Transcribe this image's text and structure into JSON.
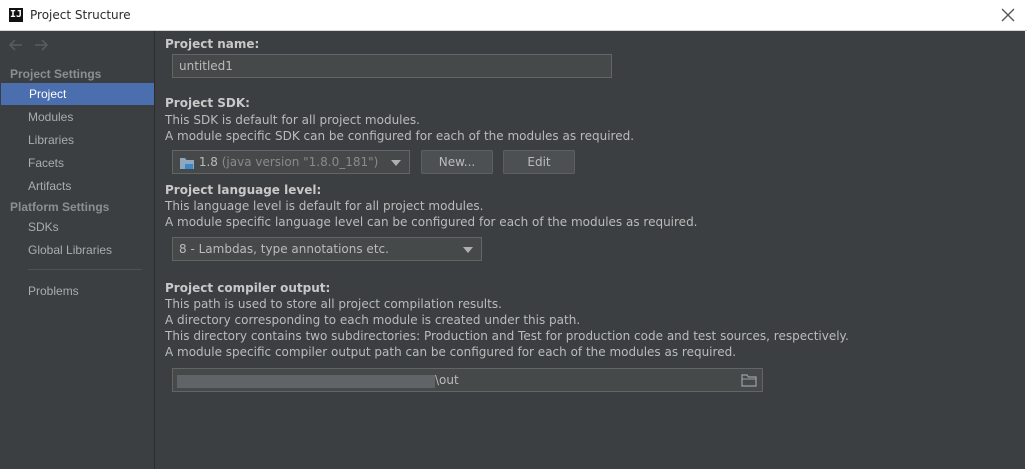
{
  "window": {
    "title": "Project Structure",
    "icon_text": "IJ"
  },
  "sidebar": {
    "project_settings_heading": "Project Settings",
    "project_settings_items": [
      {
        "label": "Project",
        "selected": true
      },
      {
        "label": "Modules"
      },
      {
        "label": "Libraries"
      },
      {
        "label": "Facets"
      },
      {
        "label": "Artifacts"
      }
    ],
    "platform_settings_heading": "Platform Settings",
    "platform_settings_items": [
      {
        "label": "SDKs"
      },
      {
        "label": "Global Libraries"
      }
    ],
    "problems_label": "Problems"
  },
  "main": {
    "project_name_label": "Project name:",
    "project_name_value": "untitled1",
    "sdk_label": "Project SDK:",
    "sdk_desc_1": "This SDK is default for all project modules.",
    "sdk_desc_2": "A module specific SDK can be configured for each of the modules as required.",
    "sdk_selected": "1.8",
    "sdk_selected_detail": "(java version \"1.8.0_181\")",
    "sdk_new_button": "New...",
    "sdk_edit_button": "Edit",
    "lang_label": "Project language level:",
    "lang_desc_1": "This language level is default for all project modules.",
    "lang_desc_2": "A module specific language level can be configured for each of the modules as required.",
    "lang_selected": "8 - Lambdas, type annotations etc.",
    "output_label": "Project compiler output:",
    "output_desc_1": "This path is used to store all project compilation results.",
    "output_desc_2": "A directory corresponding to each module is created under this path.",
    "output_desc_3": "This directory contains two subdirectories: Production and Test for production code and test sources, respectively.",
    "output_desc_4": "A module specific compiler output path can be configured for each of the modules as required.",
    "output_path_suffix": "\\out"
  },
  "colors": {
    "background": "#3c3f41",
    "selection": "#4b6eaf",
    "field": "#45494a"
  }
}
